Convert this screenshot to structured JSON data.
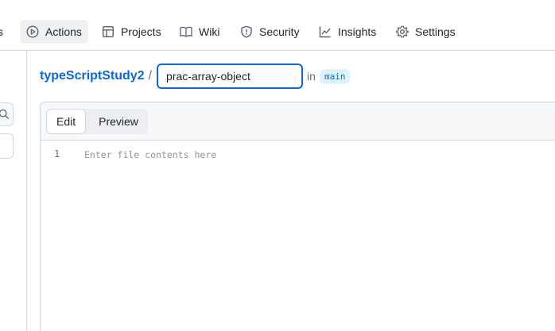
{
  "nav": {
    "cut_label": "ts",
    "items": [
      {
        "label": "Actions",
        "icon": "play-icon"
      },
      {
        "label": "Projects",
        "icon": "table-icon"
      },
      {
        "label": "Wiki",
        "icon": "book-icon"
      },
      {
        "label": "Security",
        "icon": "shield-icon"
      },
      {
        "label": "Insights",
        "icon": "graph-icon"
      },
      {
        "label": "Settings",
        "icon": "gear-icon"
      }
    ]
  },
  "breadcrumb": {
    "repo": "typeScriptStudy2",
    "separator": "/",
    "filename_value": "prac-array-object",
    "in_label": "in",
    "branch": "main"
  },
  "editor": {
    "tabs": [
      {
        "label": "Edit",
        "active": true
      },
      {
        "label": "Preview",
        "active": false
      }
    ],
    "line_number": "1",
    "placeholder": "Enter file contents here"
  },
  "colors": {
    "accent": "#0969da",
    "border": "#d0d7de",
    "header_bg": "#f6f8fa",
    "branch_bg": "#ddf4ff"
  }
}
